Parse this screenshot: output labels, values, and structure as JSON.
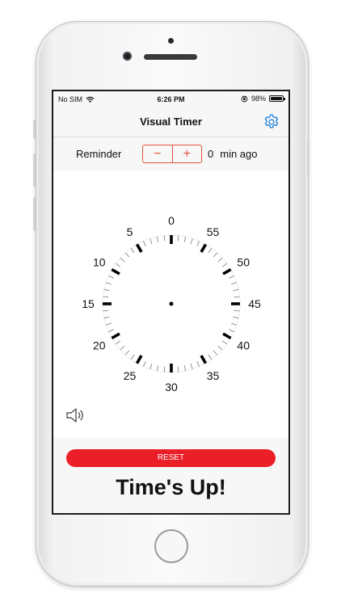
{
  "status_bar": {
    "carrier": "No SIM",
    "time": "6:26 PM",
    "battery": "98%",
    "battery_level": 0.98
  },
  "nav": {
    "title": "Visual Timer",
    "settings_icon": "gear-icon"
  },
  "reminder": {
    "label": "Reminder",
    "minus": "−",
    "plus": "+",
    "value": "0",
    "unit": "min ago"
  },
  "dial": {
    "labels": [
      "0",
      "5",
      "10",
      "15",
      "20",
      "25",
      "30",
      "35",
      "40",
      "45",
      "50",
      "55"
    ],
    "remaining_minutes": 0
  },
  "sound_icon": "speaker-icon",
  "reset_label": "RESET",
  "message": "Time's Up!",
  "colors": {
    "accent": "#e0533d",
    "reset": "#ea1f27",
    "settings": "#1a7ee0"
  }
}
